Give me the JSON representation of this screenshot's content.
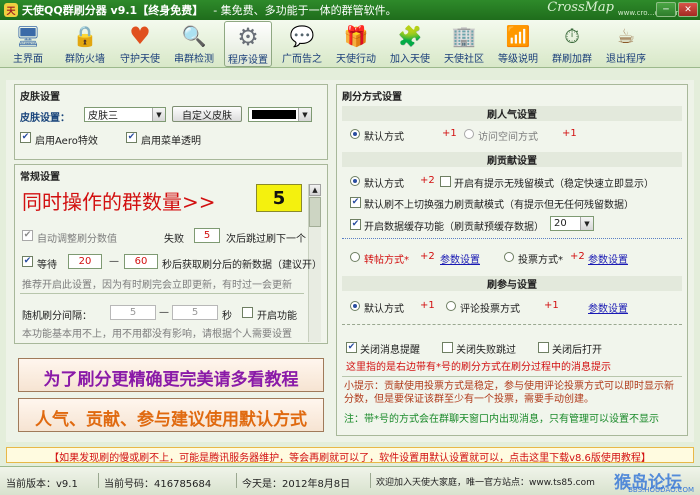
{
  "window": {
    "title": "天使QQ群刷分器 v9.1【终身免费】",
    "slogan": "- 集免费、多功能于一体的群管软件。",
    "brand": "CrossMap",
    "brand_sub": "www.cro…com.cn",
    "min": "─",
    "close": "✕"
  },
  "toolbar": [
    {
      "label": "主界面",
      "icon": "monitor-icon",
      "glyph": "🖥"
    },
    {
      "label": "群防火墙",
      "icon": "lock-icon",
      "glyph": "🔒"
    },
    {
      "label": "守护天使",
      "icon": "heart-icon",
      "glyph": "♥"
    },
    {
      "label": "串群检测",
      "icon": "magnifier-icon",
      "glyph": "🔍"
    },
    {
      "label": "程序设置",
      "icon": "gear-icon",
      "glyph": "⚙"
    },
    {
      "label": "广而告之",
      "icon": "chat-icon",
      "glyph": "💬"
    },
    {
      "label": "天使行动",
      "icon": "gift-icon",
      "glyph": "🎁"
    },
    {
      "label": "加入天使",
      "icon": "puzzle-icon",
      "glyph": "🧩"
    },
    {
      "label": "天使社区",
      "icon": "building-icon",
      "glyph": "🏢"
    },
    {
      "label": "等级说明",
      "icon": "chart-icon",
      "glyph": "📶"
    },
    {
      "label": "群刷加群",
      "icon": "clock-icon",
      "glyph": "⏱"
    },
    {
      "label": "退出程序",
      "icon": "coffee-icon",
      "glyph": "☕"
    }
  ],
  "skin": {
    "header": "皮肤设置",
    "label": "皮肤设置：",
    "value": "皮肤三",
    "custom_btn": "自定义皮肤",
    "color": "#000000",
    "aero": "启用Aero特效",
    "menu_trans": "启用菜单透明"
  },
  "general": {
    "header": "常规设置",
    "big_text": "同时操作的群数量>>",
    "big_value": "5",
    "auto_adjust": "自动调整刷分数值",
    "fail_label": "失败",
    "fail_value": "5",
    "fail_suffix": "次后跳过刷下一个",
    "wait_label": "等待",
    "wait_from": "20",
    "dash": "—",
    "wait_to": "60",
    "wait_suffix": "秒后获取刷分后的新数据（建议开）",
    "hint1": "推荐开启此设置，因为有时刷完会立即更新，有时过一会更新",
    "random_label": "随机刷分间隔：",
    "rand_from": "5",
    "rand_to": "5",
    "sec": "秒",
    "enable_fn": "开启功能",
    "hint2": "本功能基本用不上，用不用都没有影响，请根据个人需要设置"
  },
  "banners": {
    "b1": "为了刷分更精确更完美请多看教程",
    "b2": "人气、贡献、参与建议使用默认方式"
  },
  "refresh": {
    "header": "刷分方式设置",
    "pop": {
      "title": "刷人气设置",
      "default": "默认方式",
      "plus1": "+1",
      "visit": "访问空间方式",
      "plus1b": "+1"
    },
    "contrib": {
      "title": "刷贡献设置",
      "default": "默认方式",
      "plus2": "+2",
      "no_prompt": "开启有提示无残留模式（稳定快速立即显示）",
      "no_switch": "默认刷不上切换强力刷贡献模式（有提示但无任何残留数据）",
      "cache": "开启数据缓存功能（刷贡献预缓存数据）",
      "cache_val": "20"
    },
    "repost": {
      "label": "转帖方式*",
      "plus": "+2",
      "settings": "参数设置",
      "vote": "投票方式*",
      "plus_b": "+2",
      "settings_b": "参数设置"
    },
    "join": {
      "title": "刷参与设置",
      "default": "默认方式",
      "plus1": "+1",
      "comment": "评论投票方式",
      "plus1b": "+1",
      "settings": "参数设置"
    },
    "close_msg": "关闭消息提醒",
    "close_fail": "关闭失败跳过",
    "close_open": "关闭后打开",
    "note_red": "这里指的是右边带有*号的刷分方式在刷分过程中的消息提示",
    "tip": "小提示：贡献使用投票方式是稳定，参与使用评论投票方式可以即时显示新分数，但是要保证该群至少有一个投票，需要手动创建。",
    "note_green": "注：带*号的方式会在群聊天窗口内出现消息，只有管理可以设置不显示"
  },
  "notice": "【如果发现刷的慢或刷不上，可能是腾讯服务器维护，等会再刷就可以了，软件设置用默认设置就可以，点击这里下载v8.6版使用教程】",
  "status": {
    "version": "当前版本：v9.1",
    "account": "当前号码：416785684",
    "today": "今天是：2012年8月8日",
    "welcome": "欢迎加入天使大家庭，唯一官方站点：www.ts85.com",
    "watermark": "猴岛论坛",
    "watermark_sub": "BBS.HOUDAO.COM"
  }
}
